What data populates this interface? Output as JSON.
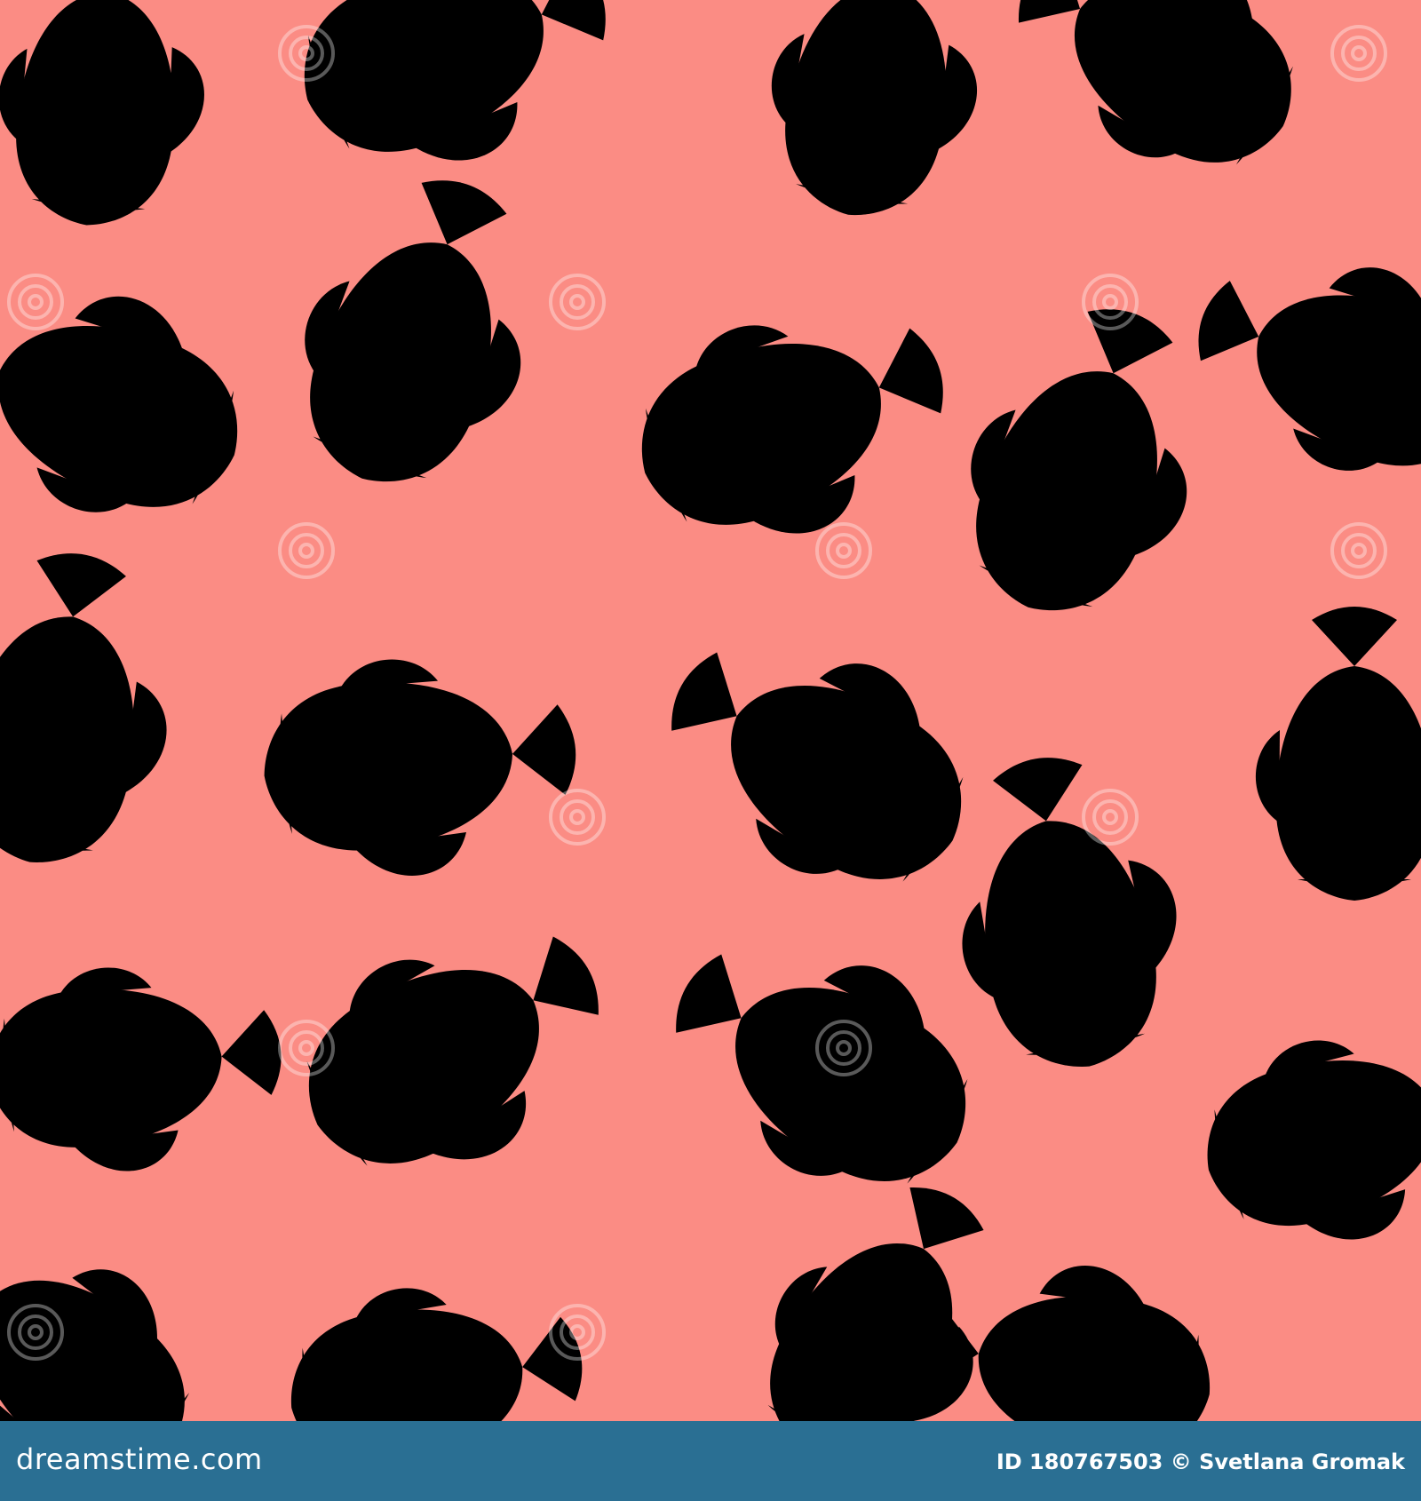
{
  "image": {
    "background_color": "#fb8c84",
    "line_color": "#3a1a17",
    "motif": "spotted-fish-outline"
  },
  "watermark": {
    "text": "dreamstime"
  },
  "footer": {
    "site": "dreamstime.com",
    "id_label": "ID 180767503",
    "copyright_symbol": "©",
    "author": "Svetlana Gromak",
    "background_color": "#2a6f93"
  }
}
